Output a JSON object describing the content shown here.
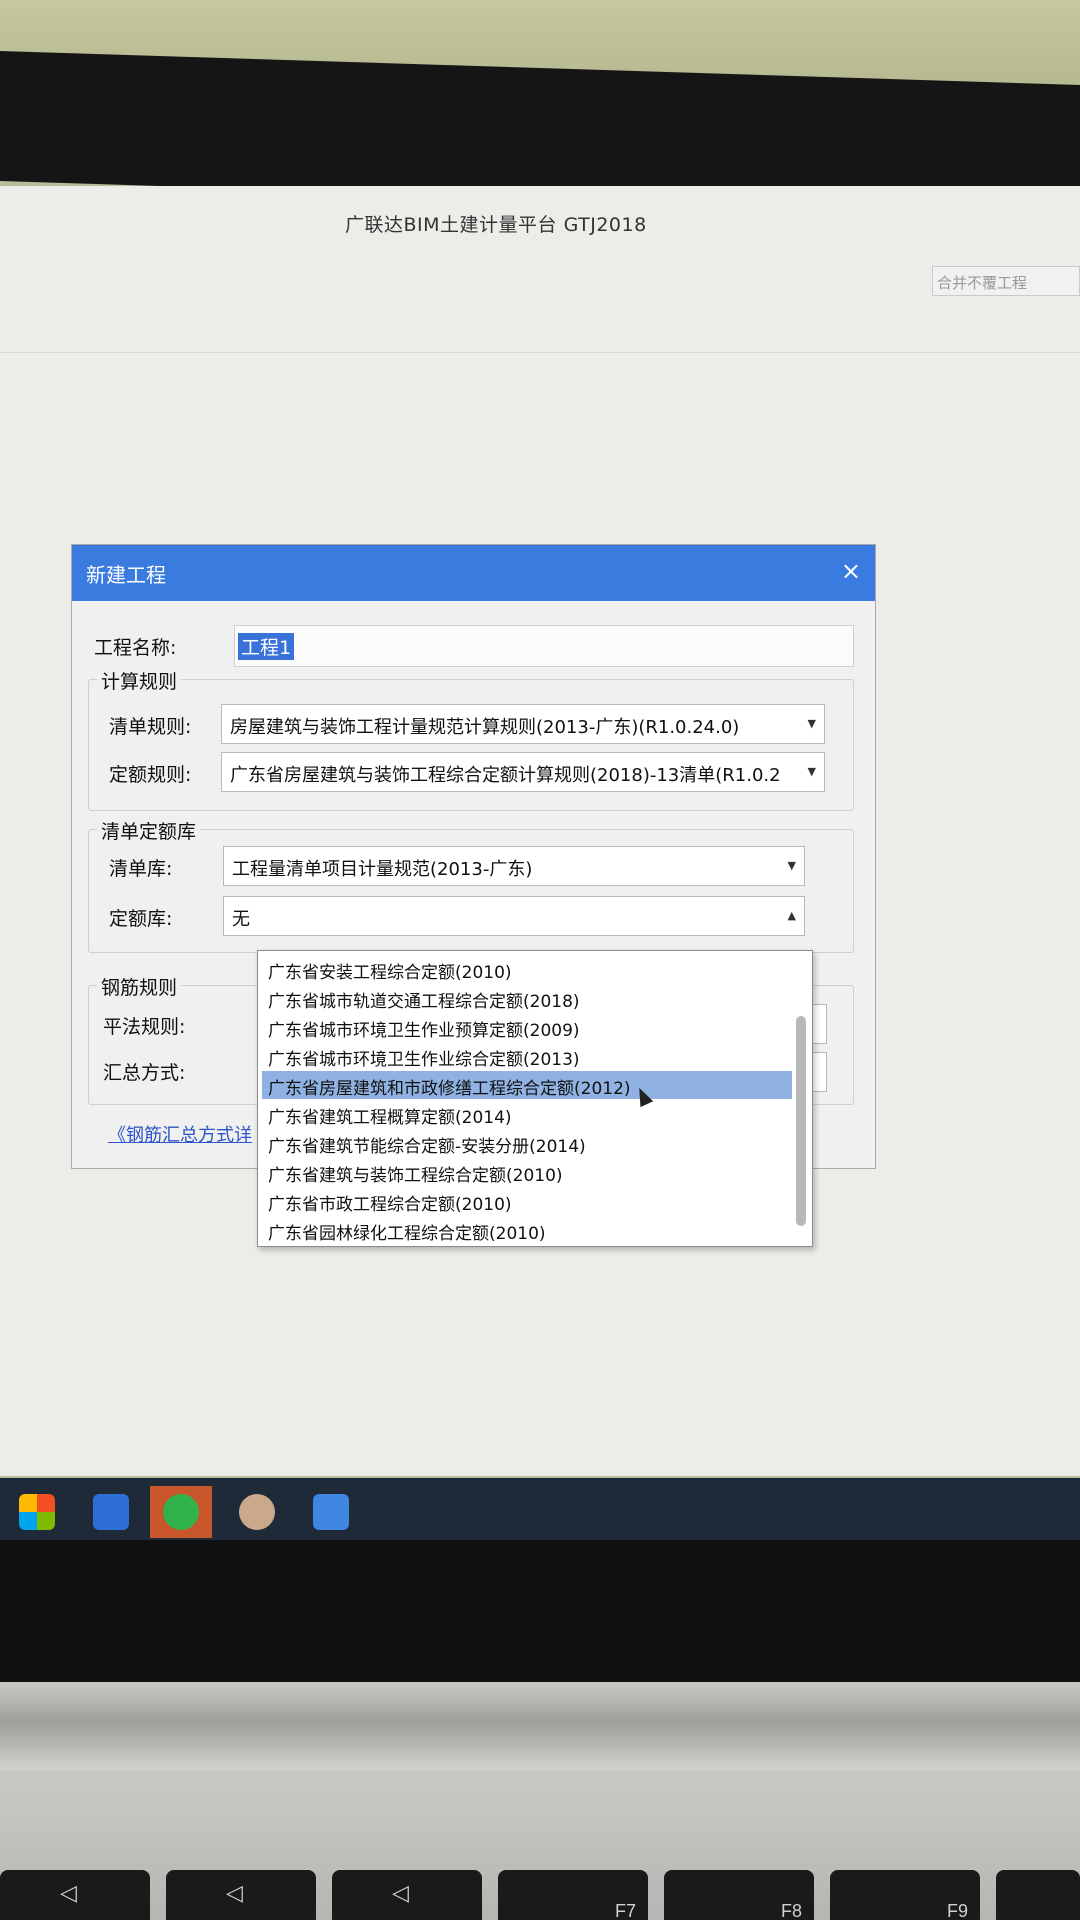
{
  "app": {
    "title": "广联达BIM土建计量平台 GTJ2018",
    "corner_button": "合并不覆工程"
  },
  "dialog": {
    "title": "新建工程",
    "close": "×",
    "project_name_label": "工程名称:",
    "project_name_value": "工程1",
    "calc_rules": {
      "group_title": "计算规则",
      "list_rule_label": "清单规则:",
      "list_rule_value": "房屋建筑与装饰工程计量规范计算规则(2013-广东)(R1.0.24.0)",
      "quota_rule_label": "定额规则:",
      "quota_rule_value": "广东省房屋建筑与装饰工程综合定额计算规则(2018)-13清单(R1.0.2"
    },
    "libraries": {
      "group_title": "清单定额库",
      "list_lib_label": "清单库:",
      "list_lib_value": "工程量清单项目计量规范(2013-广东)",
      "quota_lib_label": "定额库:",
      "quota_lib_value": "无"
    },
    "rebar": {
      "group_title": "钢筋规则",
      "flat_rule_label": "平法规则:",
      "summary_label": "汇总方式:"
    },
    "link": "《钢筋汇总方式详"
  },
  "dropdown": {
    "options": [
      "广东省安装工程综合定额(2010)",
      "广东省城市轨道交通工程综合定额(2018)",
      "广东省城市环境卫生作业预算定额(2009)",
      "广东省城市环境卫生作业综合定额(2013)",
      "广东省房屋建筑和市政修缮工程综合定额(2012)",
      "广东省建筑工程概算定额(2014)",
      "广东省建筑节能综合定额-安装分册(2014)",
      "广东省建筑与装饰工程综合定额(2010)",
      "广东省市政工程综合定额(2010)",
      "广东省园林绿化工程综合定额(2010)"
    ],
    "highlighted_index": 4
  },
  "taskbar": {
    "apps": [
      "start-icon",
      "app-icon",
      "wechat-icon",
      "avatar-icon",
      "gtj-icon"
    ],
    "active_index": 2
  },
  "keyboard": {
    "keys": [
      "F7",
      "F8",
      "F9"
    ]
  },
  "colors": {
    "titlebar": "#3a7be0",
    "highlight": "#8fb2e2",
    "taskbar": "#1f2a38"
  }
}
